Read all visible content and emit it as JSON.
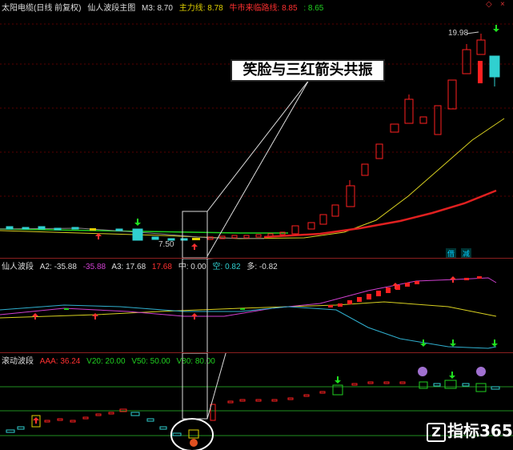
{
  "main_panel": {
    "title": "太阳电缆(日线 前复权)",
    "indicator": "仙人波段主图",
    "m3": "M3: 8.70",
    "main_line": "主力线: 8.78",
    "trend_line": "牛市来临路线: 8.85",
    "extra": ": 8.65",
    "high_label": "19.98",
    "low_label": "7.50",
    "tag1": "借",
    "tag2": "减"
  },
  "callout": {
    "text": "笑脸与三红箭头共振"
  },
  "panel2": {
    "title": "仙人波段",
    "a2": "A2: -35.88",
    "v2": "-35.88",
    "a3": "A3: 17.68",
    "v3": "17.68",
    "mid": "中: 0.00",
    "kong": "空: 0.82",
    "duo": "多: -0.82"
  },
  "panel3": {
    "title": "滚动波段",
    "aaa": "AAA: 36.24",
    "v20": "V20: 20.00",
    "v50": "V50: 50.00",
    "v80": "V80: 80.00"
  },
  "watermark": {
    "text": "指标365",
    "icon": "z-logo-icon"
  },
  "colors": {
    "up": "#ff2020",
    "down": "#30d0d0",
    "ma_yellow": "#d8d020",
    "ma_red": "#e02020",
    "ma_green": "#20d020"
  }
}
